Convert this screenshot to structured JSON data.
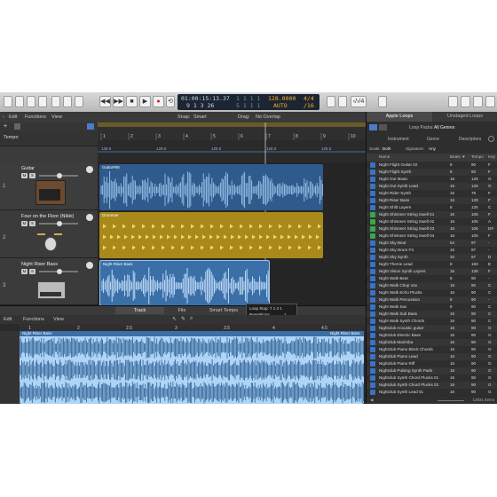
{
  "control_bar": {
    "lcd": {
      "time": "01:00:15:13.37",
      "bars": "9 1 3 26",
      "sub_a": "1 1 1 1",
      "sub_b": "5 1 1 1",
      "tempo": "128.0000",
      "tempo_mode": "AUTO",
      "signature": "4/4",
      "division": "/16"
    },
    "right_label": "‹/›/4"
  },
  "toolbar": {
    "edit": "Edit",
    "functions": "Functions",
    "view": "View",
    "snap_label": "Snap:",
    "snap_value": "Smart",
    "drag_label": "Drag:",
    "drag_value": "No Overlap"
  },
  "tempo_track": {
    "label": "Tempo"
  },
  "ruler": {
    "marks": [
      "1",
      "2",
      "3",
      "4",
      "5",
      "6",
      "7",
      "8",
      "9",
      "10"
    ]
  },
  "tempo_values": [
    "128.0",
    "128.0",
    "128.0",
    "128.0",
    "128.0"
  ],
  "tracks": [
    {
      "num": "1",
      "name": "Guitar",
      "region": "Guitar#06",
      "color": "#2e5a8c",
      "wave": "#9cc4ec"
    },
    {
      "num": "2",
      "name": "Four on the Floor (Nikki)",
      "region": "Drummer",
      "color": "#a8891a",
      "wave": "#f1d66a"
    },
    {
      "num": "3",
      "name": "Night Riser Bass",
      "region": "Night Riser Bass",
      "color": "#3a6fa8",
      "wave": "#cfe6ff"
    }
  ],
  "bottom_tabs": [
    "Track",
    "File",
    "Smart Tempo"
  ],
  "loop_popup": {
    "line1": "Loop Stop: 7 1 3 1",
    "line2": "Repetitions:",
    "value": "1"
  },
  "editor": {
    "menu": [
      "Edit",
      "Functions",
      "View"
    ],
    "region_label": "Night Riser Bass",
    "region_label_right": "Night Riser Bass",
    "ruler": [
      "1",
      "2",
      "2.5",
      "3",
      "3.5",
      "4",
      "4.5"
    ]
  },
  "library": {
    "tabs": [
      "Apple Loops",
      "Unstaged Loops"
    ],
    "loop_packs_label": "Loop Packs:",
    "loop_packs_value": "All Genres",
    "categories": [
      "Instrument",
      "Genre",
      "Descriptors"
    ],
    "scale_label": "Scale:",
    "scale_value": "Both",
    "signature_label": "Signature:",
    "signature_value": "Any",
    "columns": {
      "name": "Name",
      "beats": "Beats",
      "fav": "♥",
      "tempo": "Tempo",
      "key": "Key"
    },
    "loops": [
      {
        "name": "Night Flight Guitar 02",
        "beats": "8",
        "tempo": "90",
        "key": "F",
        "icon": "#3a72c6"
      },
      {
        "name": "Night Flight Synth",
        "beats": "8",
        "tempo": "90",
        "key": "F",
        "icon": "#3a72c6"
      },
      {
        "name": "Night Out Music",
        "beats": "16",
        "tempo": "128",
        "key": "G",
        "icon": "#3a72c6"
      },
      {
        "name": "Night Out Synth Lead",
        "beats": "16",
        "tempo": "128",
        "key": "G",
        "icon": "#3a72c6"
      },
      {
        "name": "Night Rider Synth",
        "beats": "16",
        "tempo": "76",
        "key": "F",
        "icon": "#3a72c6"
      },
      {
        "name": "Night Riser Bass",
        "beats": "16",
        "tempo": "128",
        "key": "F",
        "icon": "#3a72c6"
      },
      {
        "name": "Night Shift Layers",
        "beats": "8",
        "tempo": "125",
        "key": "C",
        "icon": "#3a72c6"
      },
      {
        "name": "Night Shimmer String Swell 01",
        "beats": "16",
        "tempo": "105",
        "key": "F",
        "icon": "#3aa84a"
      },
      {
        "name": "Night Shimmer String Swell 02",
        "beats": "16",
        "tempo": "105",
        "key": "A",
        "icon": "#3aa84a"
      },
      {
        "name": "Night Shimmer String Swell 03",
        "beats": "16",
        "tempo": "105",
        "key": "D#",
        "icon": "#3aa84a"
      },
      {
        "name": "Night Shimmer String Swell 04",
        "beats": "16",
        "tempo": "105",
        "key": "F",
        "icon": "#3aa84a"
      },
      {
        "name": "Night Sky Beat",
        "beats": "64",
        "tempo": "97",
        "key": "-",
        "icon": "#3a72c6"
      },
      {
        "name": "Night Sky Drum FX",
        "beats": "16",
        "tempo": "97",
        "key": "-",
        "icon": "#3a72c6"
      },
      {
        "name": "Night Sky Synth",
        "beats": "32",
        "tempo": "97",
        "key": "D",
        "icon": "#3a72c6"
      },
      {
        "name": "Night Theme Lead",
        "beats": "8",
        "tempo": "160",
        "key": "E",
        "icon": "#3a72c6"
      },
      {
        "name": "Night Vision Synth Layers",
        "beats": "16",
        "tempo": "128",
        "key": "F",
        "icon": "#3a72c6"
      },
      {
        "name": "Night Walk Beat",
        "beats": "8",
        "tempo": "90",
        "key": "-",
        "icon": "#3a72c6"
      },
      {
        "name": "Night Walk Chop Vox",
        "beats": "16",
        "tempo": "90",
        "key": "C",
        "icon": "#3a72c6"
      },
      {
        "name": "Night Walk Echo Plucks",
        "beats": "16",
        "tempo": "90",
        "key": "C",
        "icon": "#3a72c6"
      },
      {
        "name": "Night Walk Percussion",
        "beats": "8",
        "tempo": "90",
        "key": "-",
        "icon": "#3a72c6"
      },
      {
        "name": "Night Walk Sax",
        "beats": "8",
        "tempo": "90",
        "key": "C",
        "icon": "#3a72c6"
      },
      {
        "name": "Night Walk Sub Bass",
        "beats": "16",
        "tempo": "90",
        "key": "C",
        "icon": "#3a72c6"
      },
      {
        "name": "Night Walk Synth Chords",
        "beats": "16",
        "tempo": "90",
        "key": "C",
        "icon": "#3a72c6"
      },
      {
        "name": "Nightclub Acoustic guitar",
        "beats": "16",
        "tempo": "90",
        "key": "G",
        "icon": "#3a72c6"
      },
      {
        "name": "Nightclub Electric Bass",
        "beats": "16",
        "tempo": "90",
        "key": "G",
        "icon": "#3a72c6"
      },
      {
        "name": "Nightclub Marimba",
        "beats": "16",
        "tempo": "90",
        "key": "G",
        "icon": "#3a72c6"
      },
      {
        "name": "Nightclub Piano Block Chords",
        "beats": "16",
        "tempo": "90",
        "key": "G",
        "icon": "#3a72c6"
      },
      {
        "name": "Nightclub Piano Lead",
        "beats": "16",
        "tempo": "90",
        "key": "G",
        "icon": "#3a72c6"
      },
      {
        "name": "Nightclub Piano Riff",
        "beats": "16",
        "tempo": "90",
        "key": "G",
        "icon": "#3a72c6"
      },
      {
        "name": "Nightclub Pulsing Synth Pads",
        "beats": "16",
        "tempo": "90",
        "key": "G",
        "icon": "#3a72c6"
      },
      {
        "name": "Nightclub Synth Chord Plucks 01",
        "beats": "16",
        "tempo": "90",
        "key": "G",
        "icon": "#3a72c6"
      },
      {
        "name": "Nightclub Synth Chord Plucks 02",
        "beats": "16",
        "tempo": "90",
        "key": "G",
        "icon": "#3a72c6"
      },
      {
        "name": "Nightclub Synth Lead 01",
        "beats": "16",
        "tempo": "90",
        "key": "G",
        "icon": "#3a72c6"
      }
    ],
    "footer_count": "12831 items"
  }
}
